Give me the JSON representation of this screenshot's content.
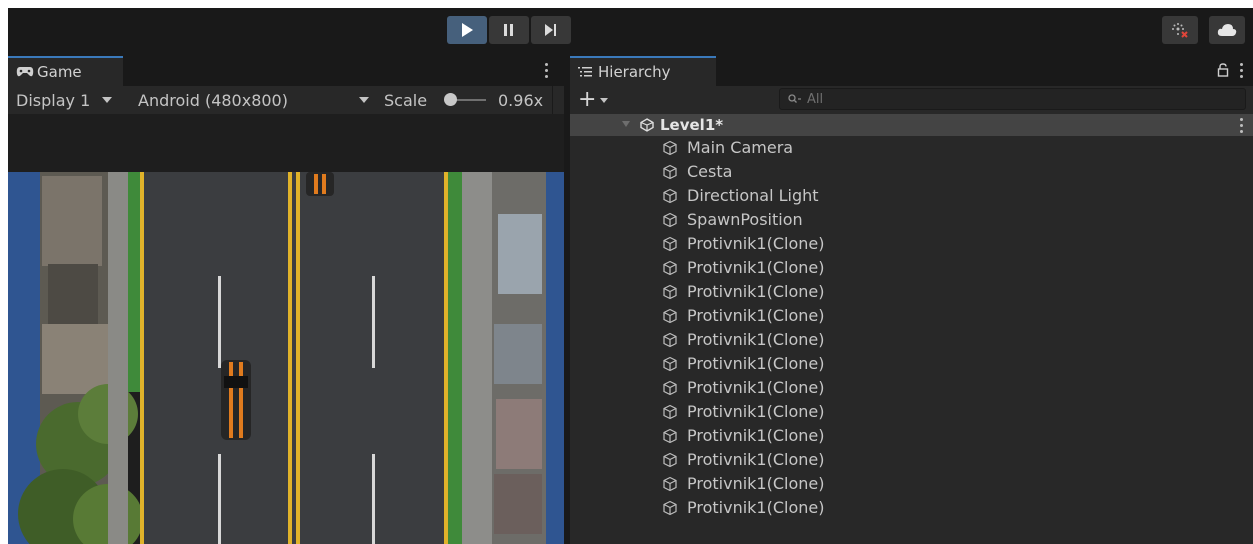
{
  "toolbar": {
    "play_icon": "play-icon",
    "pause_icon": "pause-icon",
    "step_icon": "step-icon",
    "collab_icon": "collab-error-icon",
    "cloud_icon": "cloud-icon"
  },
  "game": {
    "tab_label": "Game",
    "display": "Display 1",
    "resolution": "Android (480x800)",
    "scale_label": "Scale",
    "scale_value": "0.96x"
  },
  "hierarchy": {
    "tab_label": "Hierarchy",
    "search_placeholder": "All",
    "add_label": "+",
    "scene": "Level1*",
    "items": [
      "Main Camera",
      "Cesta",
      "Directional Light",
      "SpawnPosition",
      "Protivnik1(Clone)",
      "Protivnik1(Clone)",
      "Protivnik1(Clone)",
      "Protivnik1(Clone)",
      "Protivnik1(Clone)",
      "Protivnik1(Clone)",
      "Protivnik1(Clone)",
      "Protivnik1(Clone)",
      "Protivnik1(Clone)",
      "Protivnik1(Clone)",
      "Protivnik1(Clone)",
      "Protivnik1(Clone)"
    ]
  },
  "colors": {
    "play_active": "#46607c",
    "tab_accent": "#3a79bb",
    "road": "#3b3d40",
    "lane_yellow": "#e0b32a",
    "car_orange": "#e07b1e"
  }
}
